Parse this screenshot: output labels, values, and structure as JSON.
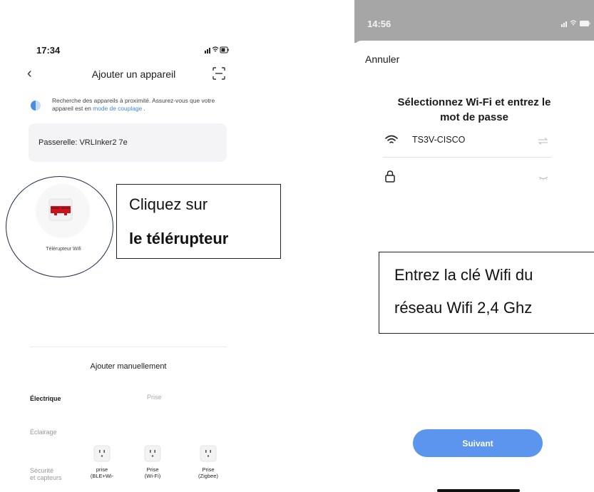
{
  "left_screen": {
    "status_time": "17:34",
    "header": {
      "title": "Ajouter un appareil"
    },
    "info": {
      "text": "Recherche des appareils à proximité. Assurez-vous que votre appareil est en ",
      "link": "mode de couplage",
      "suffix": " ."
    },
    "gateway": {
      "label": "Passerelle: VRLInker2 7e"
    },
    "device": {
      "label": "Télérupteur Wifi"
    },
    "callout": {
      "line1": "Cliquez sur",
      "line2": "le télérupteur"
    },
    "manual": {
      "title": "Ajouter manuellement",
      "categories": [
        "Électrique",
        "Éclairage",
        "Sécurité\net capteurs"
      ],
      "column_header": "Prise",
      "items": [
        {
          "label": "prise\n(BLE+Wi-"
        },
        {
          "label": "Prise\n(Wi-Fi)"
        },
        {
          "label": "Prise\n(Zigbee)"
        }
      ]
    }
  },
  "right_screen": {
    "status_time": "14:56",
    "cancel_label": "Annuler",
    "title": "Sélectionnez Wi-Fi et entrez le mot de passe",
    "ssid": "TS3V-CISCO",
    "password_value": "",
    "callout": {
      "line1": "Entrez la clé Wifi du",
      "line2": "réseau Wifi 2,4 Ghz"
    },
    "next_label": "Suivant"
  },
  "colors": {
    "accent": "#5b95ee",
    "link": "#3d86e8",
    "status_bar_right": "#a6a6a6",
    "callout_border": "#222222",
    "circle_outline": "#1e2a4a",
    "device_red": "#c8141e"
  }
}
